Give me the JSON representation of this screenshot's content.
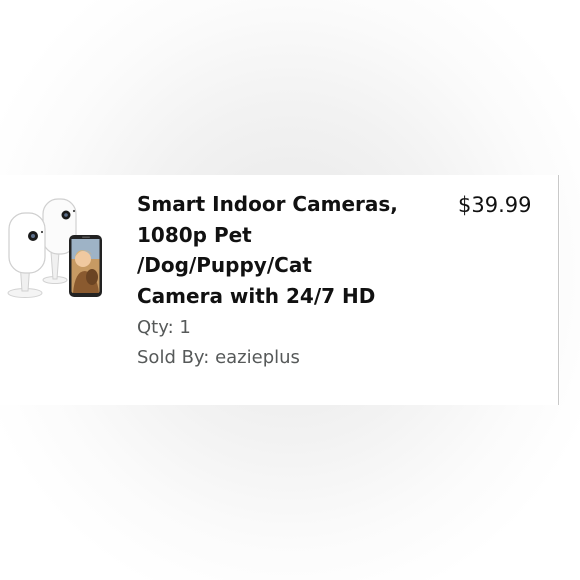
{
  "product": {
    "title": "Smart Indoor Cameras,\n1080p Pet\n/Dog/Puppy/Cat\nCamera with 24/7 HD",
    "price": "$39.99",
    "qty_text": "Qty: 1",
    "seller_text": "Sold By: eazieplus",
    "image_icon": "indoor-camera-product-image"
  },
  "colors": {
    "text_primary": "#111111",
    "text_secondary": "#565959",
    "card_background": "#ffffff"
  }
}
